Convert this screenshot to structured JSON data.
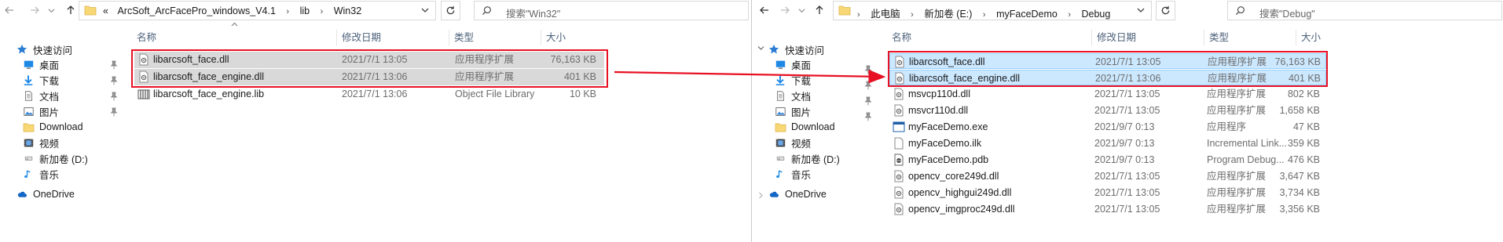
{
  "left": {
    "breadcrumb_prefix": "«",
    "breadcrumbs": [
      "ArcSoft_ArcFacePro_windows_V4.1",
      "lib",
      "Win32"
    ],
    "search_placeholder": "搜索\"Win32\"",
    "columns": {
      "name": "名称",
      "date": "修改日期",
      "type": "类型",
      "size": "大小"
    },
    "files": [
      {
        "name": "libarcsoft_face.dll",
        "date": "2021/7/1 13:05",
        "type": "应用程序扩展",
        "size": "76,163 KB",
        "icon": "dll-file-icon",
        "selected": true
      },
      {
        "name": "libarcsoft_face_engine.dll",
        "date": "2021/7/1 13:06",
        "type": "应用程序扩展",
        "size": "401 KB",
        "icon": "dll-file-icon",
        "selected": true
      },
      {
        "name": "libarcsoft_face_engine.lib",
        "date": "2021/7/1 13:06",
        "type": "Object File Library",
        "size": "10 KB",
        "icon": "lib-file-icon",
        "selected": false
      }
    ],
    "nav": [
      {
        "label": "快速访问",
        "icon": "star-icon"
      },
      {
        "label": "桌面",
        "icon": "desktop-icon"
      },
      {
        "label": "下载",
        "icon": "download-icon"
      },
      {
        "label": "文档",
        "icon": "document-icon"
      },
      {
        "label": "图片",
        "icon": "pictures-icon"
      },
      {
        "label": "Download",
        "icon": "folder-icon"
      },
      {
        "label": "视频",
        "icon": "video-icon"
      },
      {
        "label": "新加卷 (D:)",
        "icon": "drive-icon"
      },
      {
        "label": "音乐",
        "icon": "music-icon"
      },
      {
        "label": "OneDrive",
        "icon": "cloud-icon"
      }
    ]
  },
  "right": {
    "breadcrumbs": [
      "此电脑",
      "新加卷 (E:)",
      "myFaceDemo",
      "Debug"
    ],
    "search_placeholder": "搜索\"Debug\"",
    "columns": {
      "name": "名称",
      "date": "修改日期",
      "type": "类型",
      "size": "大小"
    },
    "files": [
      {
        "name": "libarcsoft_face.dll",
        "date": "2021/7/1 13:05",
        "type": "应用程序扩展",
        "size": "76,163 KB",
        "icon": "dll-file-icon",
        "selected": true
      },
      {
        "name": "libarcsoft_face_engine.dll",
        "date": "2021/7/1 13:06",
        "type": "应用程序扩展",
        "size": "401 KB",
        "icon": "dll-file-icon",
        "selected": true
      },
      {
        "name": "msvcp110d.dll",
        "date": "2021/7/1 13:05",
        "type": "应用程序扩展",
        "size": "802 KB",
        "icon": "dll-file-icon",
        "selected": false
      },
      {
        "name": "msvcr110d.dll",
        "date": "2021/7/1 13:05",
        "type": "应用程序扩展",
        "size": "1,658 KB",
        "icon": "dll-file-icon",
        "selected": false
      },
      {
        "name": "myFaceDemo.exe",
        "date": "2021/9/7 0:13",
        "type": "应用程序",
        "size": "47 KB",
        "icon": "exe-file-icon",
        "selected": false
      },
      {
        "name": "myFaceDemo.ilk",
        "date": "2021/9/7 0:13",
        "type": "Incremental Link...",
        "size": "359 KB",
        "icon": "ilk-file-icon",
        "selected": false
      },
      {
        "name": "myFaceDemo.pdb",
        "date": "2021/9/7 0:13",
        "type": "Program Debug...",
        "size": "476 KB",
        "icon": "pdb-file-icon",
        "selected": false
      },
      {
        "name": "opencv_core249d.dll",
        "date": "2021/7/1 13:05",
        "type": "应用程序扩展",
        "size": "3,647 KB",
        "icon": "dll-file-icon",
        "selected": false
      },
      {
        "name": "opencv_highgui249d.dll",
        "date": "2021/7/1 13:05",
        "type": "应用程序扩展",
        "size": "3,734 KB",
        "icon": "dll-file-icon",
        "selected": false
      },
      {
        "name": "opencv_imgproc249d.dll",
        "date": "2021/7/1 13:05",
        "type": "应用程序扩展",
        "size": "3,356 KB",
        "icon": "dll-file-icon",
        "selected": false
      }
    ],
    "nav": [
      {
        "label": "快速访问",
        "icon": "star-icon"
      },
      {
        "label": "桌面",
        "icon": "desktop-icon"
      },
      {
        "label": "下载",
        "icon": "download-icon"
      },
      {
        "label": "文档",
        "icon": "document-icon"
      },
      {
        "label": "图片",
        "icon": "pictures-icon"
      },
      {
        "label": "Download",
        "icon": "folder-icon"
      },
      {
        "label": "视频",
        "icon": "video-icon"
      },
      {
        "label": "新加卷 (D:)",
        "icon": "drive-icon"
      },
      {
        "label": "音乐",
        "icon": "music-icon"
      },
      {
        "label": "OneDrive",
        "icon": "cloud-icon"
      }
    ]
  },
  "colors": {
    "highlight": "#e81123",
    "selection_blue": "#cce8ff",
    "selection_gray": "#d9d9d9",
    "header_text": "#4c607a"
  }
}
